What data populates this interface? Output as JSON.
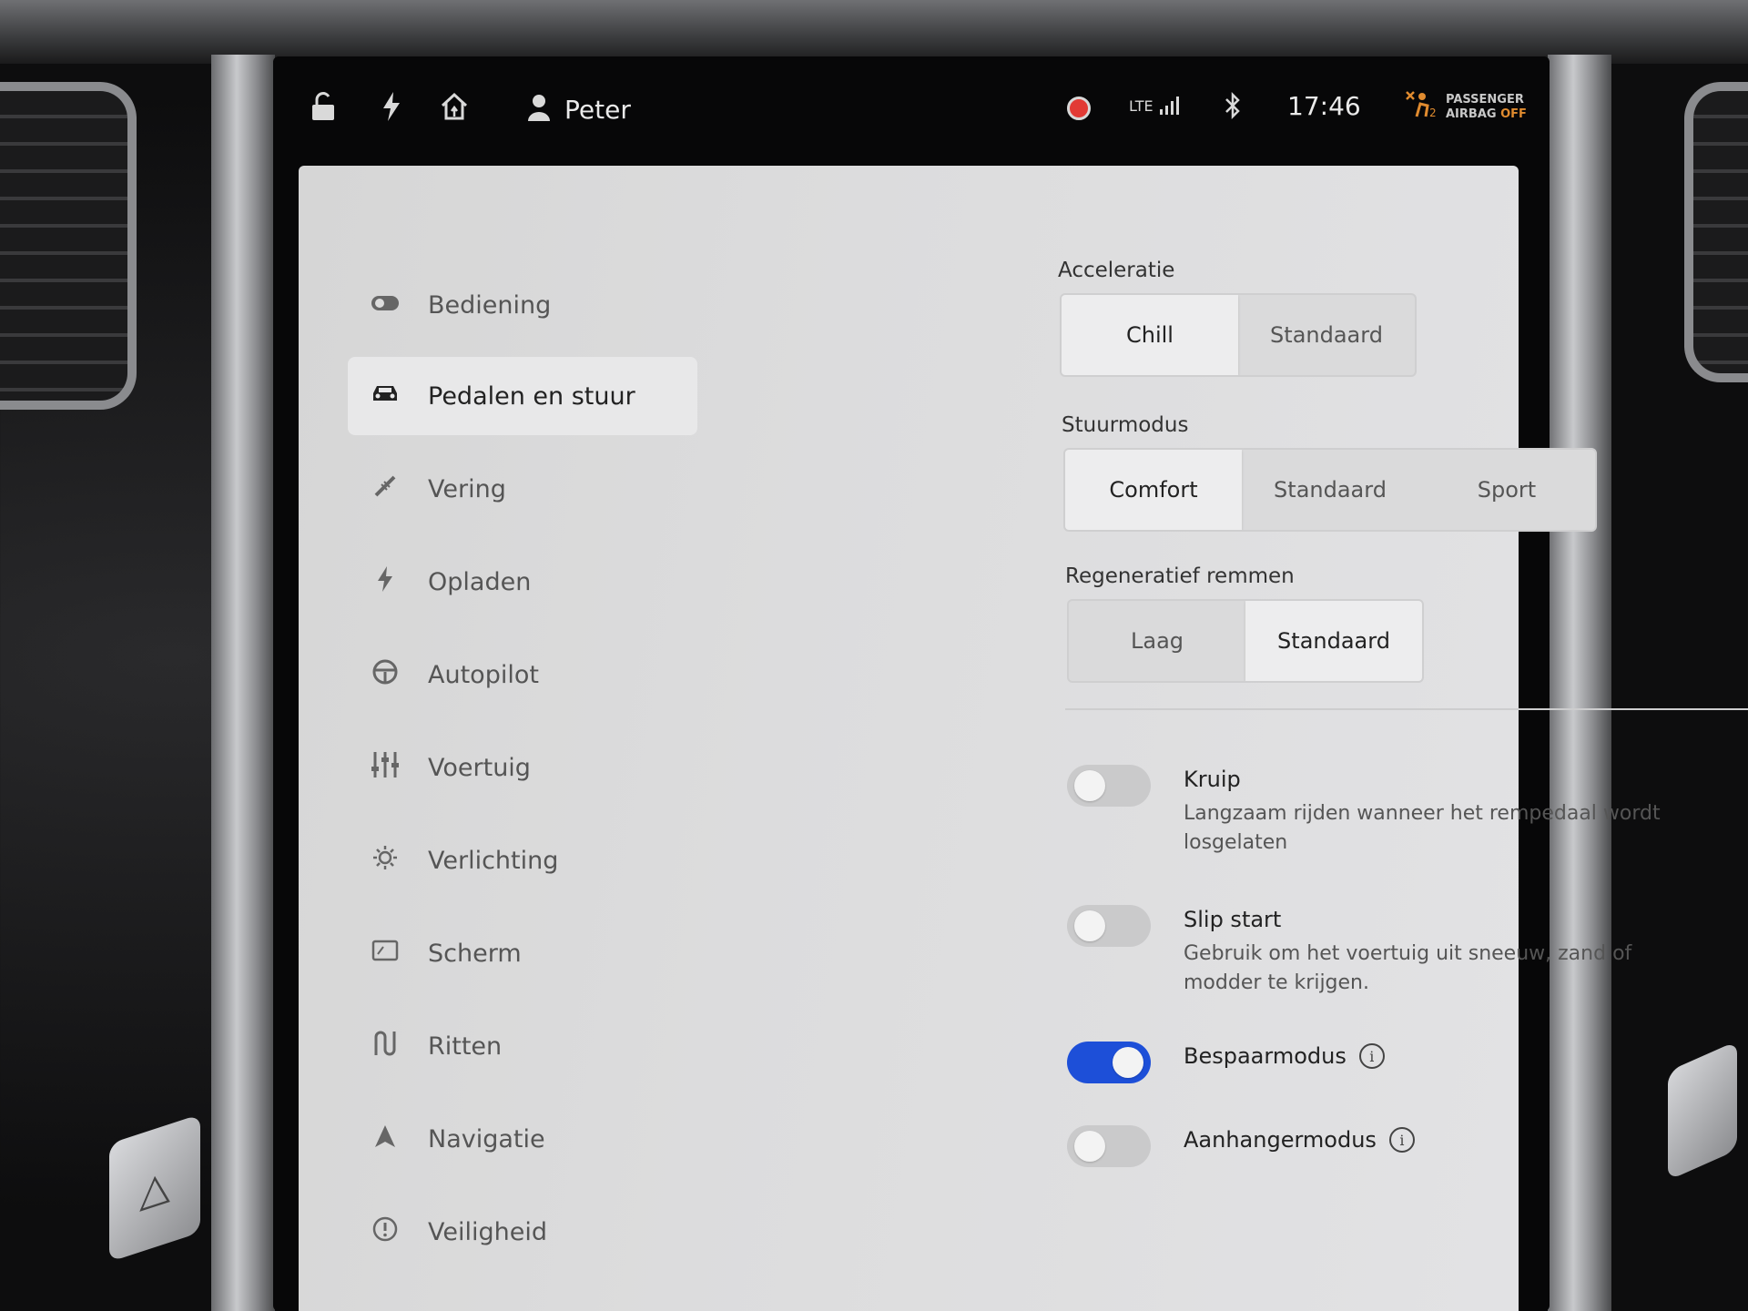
{
  "status_bar": {
    "icons": {
      "lock": "unlock-icon",
      "charge": "lightning-icon",
      "home": "home-icon"
    },
    "user_icon": "person-icon",
    "user_name": "Peter",
    "recording_indicator": "record-dot-icon",
    "network_label": "LTE",
    "signal_bars": 4,
    "bluetooth_icon": "bluetooth-icon",
    "time": "17:46",
    "airbag": {
      "icon": "airbag-off-icon",
      "line1": "PASSENGER",
      "line2_prefix": "AIRBAG",
      "line2_state": "OFF"
    }
  },
  "sidebar": {
    "items": [
      {
        "label": "Bediening",
        "icon": "toggle-icon",
        "active": false
      },
      {
        "label": "Pedalen en stuur",
        "icon": "car-icon",
        "active": true
      },
      {
        "label": "Vering",
        "icon": "suspension-icon",
        "active": false
      },
      {
        "label": "Opladen",
        "icon": "lightning-icon",
        "active": false
      },
      {
        "label": "Autopilot",
        "icon": "steering-wheel-icon",
        "active": false
      },
      {
        "label": "Voertuig",
        "icon": "sliders-icon",
        "active": false
      },
      {
        "label": "Verlichting",
        "icon": "light-icon",
        "active": false
      },
      {
        "label": "Scherm",
        "icon": "screen-icon",
        "active": false
      },
      {
        "label": "Ritten",
        "icon": "trips-icon",
        "active": false
      },
      {
        "label": "Navigatie",
        "icon": "navigation-arrow-icon",
        "active": false
      },
      {
        "label": "Veiligheid",
        "icon": "safety-icon",
        "active": false
      }
    ]
  },
  "settings": {
    "acceleration": {
      "label": "Acceleratie",
      "options": [
        "Chill",
        "Standaard"
      ],
      "selected": "Chill"
    },
    "steering_mode": {
      "label": "Stuurmodus",
      "options": [
        "Comfort",
        "Standaard",
        "Sport"
      ],
      "selected": "Comfort"
    },
    "regen_braking": {
      "label": "Regeneratief remmen",
      "options": [
        "Laag",
        "Standaard"
      ],
      "selected": "Standaard"
    },
    "toggles": [
      {
        "title": "Kruip",
        "description": "Langzaam rijden wanneer het rempedaal wordt losgelaten",
        "on": false,
        "info": false
      },
      {
        "title": "Slip start",
        "description": "Gebruik om het voertuig uit sneeuw, zand of modder te krijgen.",
        "on": false,
        "info": false
      },
      {
        "title": "Bespaarmodus",
        "description": "",
        "on": true,
        "info": true
      },
      {
        "title": "Aanhangermodus",
        "description": "",
        "on": false,
        "info": true
      }
    ],
    "info_glyph": "i"
  },
  "colors": {
    "toggle_on": "#1d4fd8",
    "recording": "#e23a35",
    "airbag_warning": "#e08b2f"
  }
}
